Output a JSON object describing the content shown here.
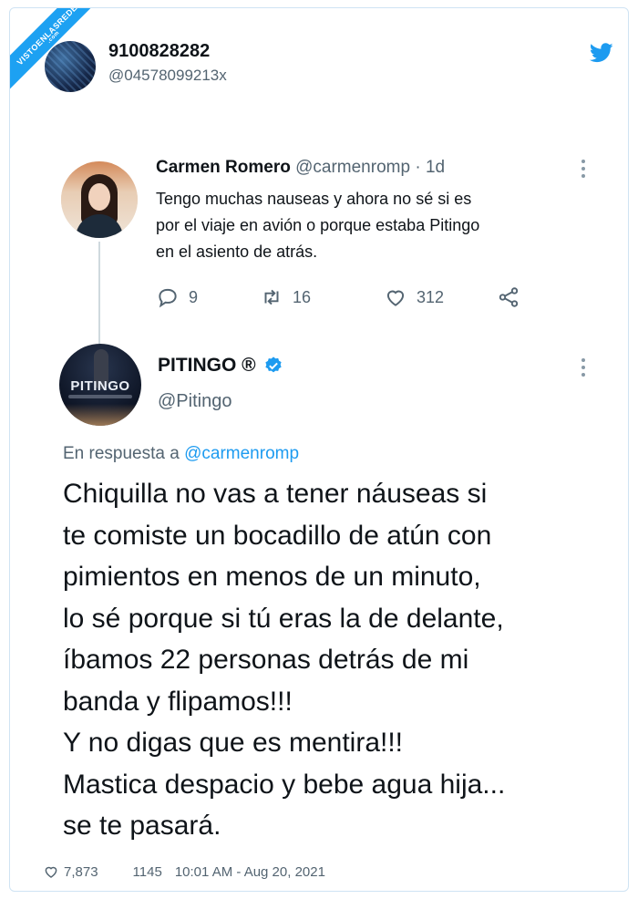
{
  "ribbon": {
    "text": "VISTOENLASREDES",
    "sub": ".com"
  },
  "header": {
    "display_name": "9100828282",
    "handle": "@04578099213x",
    "logo_icon": "twitter-bird-icon"
  },
  "quoted_tweet": {
    "name": "Carmen Romero",
    "handle": "@carmenromp",
    "separator": "·",
    "time": "1d",
    "text_lines": [
      "Tengo muchas nauseas y ahora no sé si es",
      "por el viaje en avión o porque estaba Pitingo",
      "en el asiento de atrás."
    ],
    "replies": "9",
    "retweets": "16",
    "likes": "312"
  },
  "main_tweet": {
    "name": "PITINGO ®",
    "handle": "@Pitingo",
    "avatar_text": "PITINGO",
    "reply_prefix": "En respuesta a",
    "reply_mention": "@carmenromp",
    "text_lines": [
      "Chiquilla no vas a tener náuseas si",
      "te comiste un bocadillo de atún con",
      "pimientos en menos de un minuto,",
      "lo sé porque si tú eras la de delante,",
      "íbamos  22 personas detrás de mi",
      "banda y flipamos!!!",
      "Y no digas que es mentira!!!",
      "Mastica despacio y bebe agua hija...",
      "se te pasará."
    ]
  },
  "footer": {
    "likes": "7,873",
    "retweets": "1145",
    "timestamp": "10:01 AM - Aug 20, 2021"
  },
  "colors": {
    "accent": "#1d9bf0",
    "muted": "#536471",
    "text": "#0f1419"
  }
}
